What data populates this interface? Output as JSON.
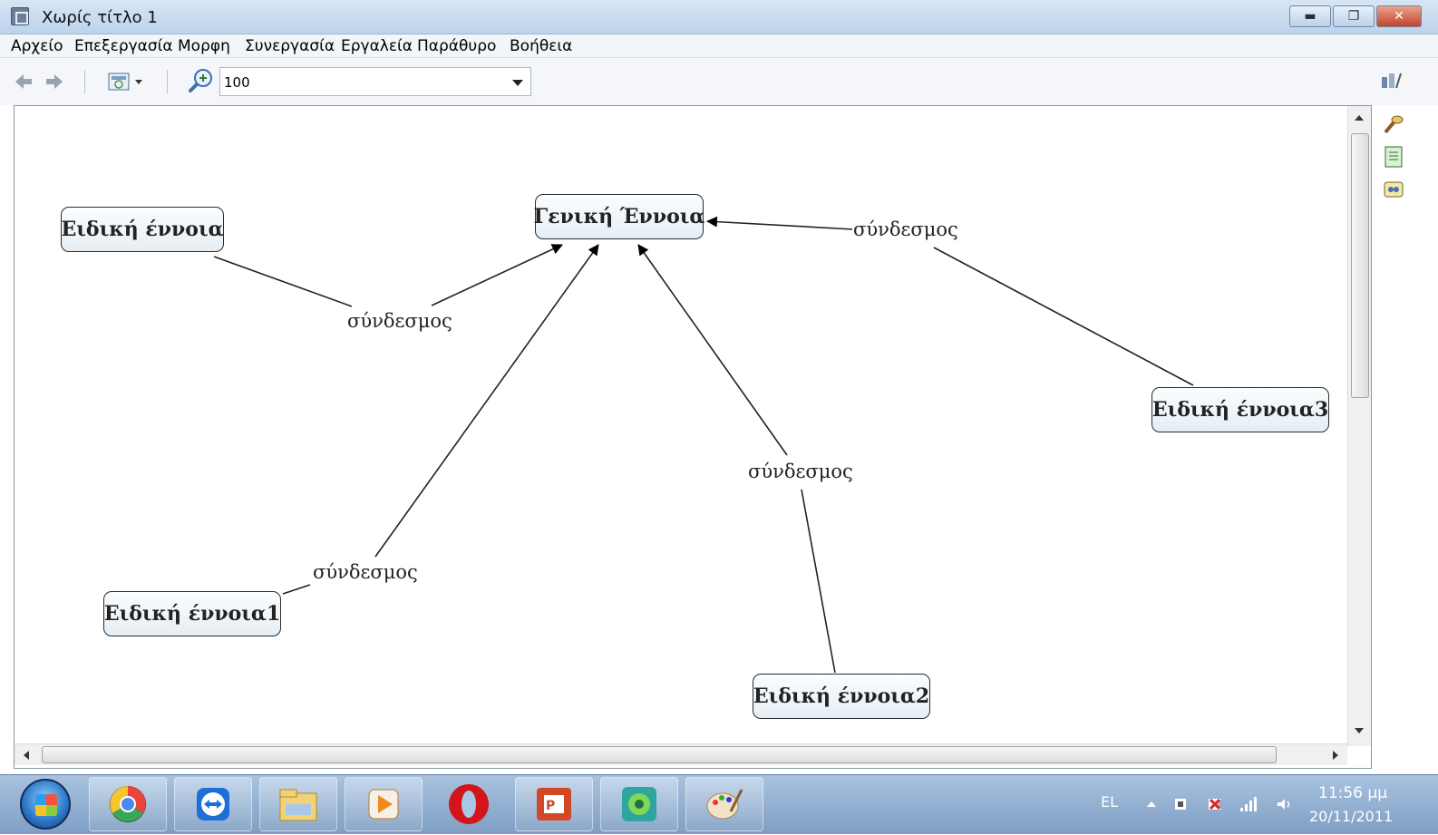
{
  "window": {
    "title": "Χωρίς τίτλο 1"
  },
  "menu": [
    "Αρχείο",
    "Επεξεργασία",
    "Μορφη",
    "Συνεργασία",
    "Εργαλεία",
    "Παράθυρο",
    "Βοήθεια"
  ],
  "toolbar": {
    "zoom_value": "100"
  },
  "concept_map": {
    "concepts": [
      {
        "id": "general",
        "label": "Γενική Έννοια"
      },
      {
        "id": "specific",
        "label": "Ειδική έννοια"
      },
      {
        "id": "specific1",
        "label": "Ειδική έννοια1"
      },
      {
        "id": "specific2",
        "label": "Ειδική έννοια2"
      },
      {
        "id": "specific3",
        "label": "Ειδική έννοια3"
      }
    ],
    "links": [
      {
        "label": "σύνδεσμος",
        "from": "specific",
        "to": "general"
      },
      {
        "label": "σύνδεσμος",
        "from": "specific1",
        "to": "general"
      },
      {
        "label": "σύνδεσμος",
        "from": "specific2",
        "to": "general"
      },
      {
        "label": "σύνδεσμος",
        "from": "specific3",
        "to": "general"
      }
    ]
  },
  "taskbar": {
    "apps": [
      "chrome-icon",
      "teamviewer-icon",
      "explorer-icon",
      "media-player-icon",
      "opera-icon",
      "powerpoint-icon",
      "cmaptools-icon",
      "paint-icon"
    ],
    "language": "EL",
    "time": "11:56 μμ",
    "date": "20/11/2011"
  }
}
